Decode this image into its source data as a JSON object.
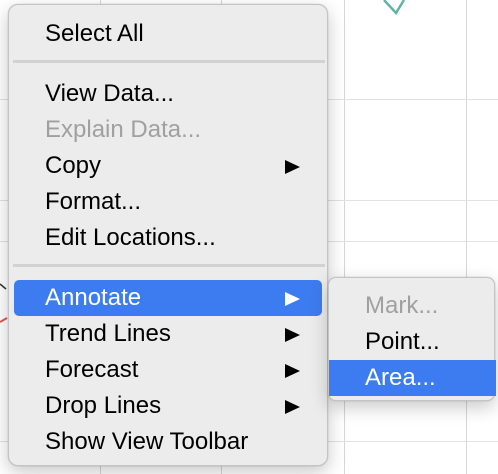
{
  "context_menu": {
    "items": [
      {
        "label": "Select All"
      },
      {
        "label": "View Data..."
      },
      {
        "label": "Explain Data..."
      },
      {
        "label": "Copy"
      },
      {
        "label": "Format..."
      },
      {
        "label": "Edit Locations..."
      },
      {
        "label": "Annotate"
      },
      {
        "label": "Trend Lines"
      },
      {
        "label": "Forecast"
      },
      {
        "label": "Drop Lines"
      },
      {
        "label": "Show View Toolbar"
      }
    ],
    "disabled_items": [
      "Explain Data..."
    ],
    "selected_item": "Annotate",
    "submenu_items": [
      "Copy",
      "Annotate",
      "Trend Lines",
      "Forecast",
      "Drop Lines"
    ]
  },
  "annotate_submenu": {
    "items": [
      {
        "label": "Mark..."
      },
      {
        "label": "Point..."
      },
      {
        "label": "Area..."
      }
    ],
    "disabled_items": [
      "Mark..."
    ],
    "selected_item": "Area..."
  },
  "colors": {
    "selection": "#3d7cf0",
    "menu_background": "#ececec",
    "disabled_text": "#a0a0a0",
    "chart_line_teal": "#5fb3a8",
    "chart_line_red": "#e0564f"
  }
}
